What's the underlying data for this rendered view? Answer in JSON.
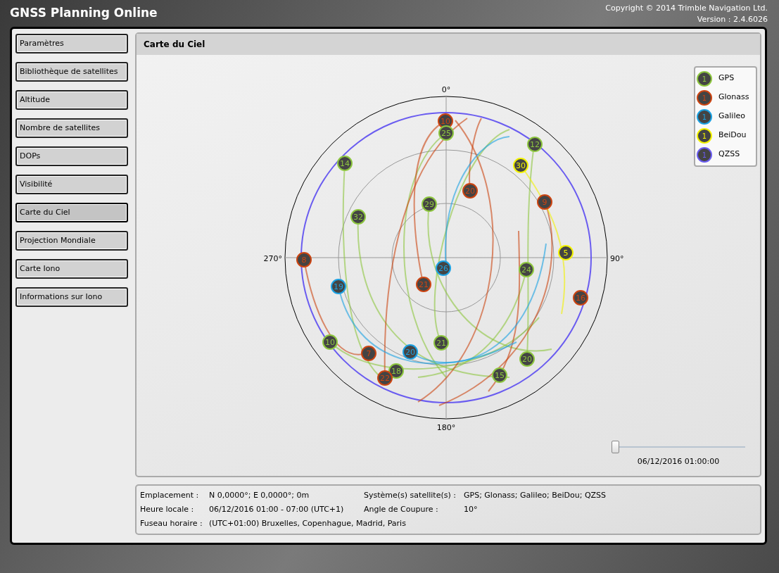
{
  "app": {
    "title": "GNSS Planning Online",
    "copyright": "Copyright © 2014 Trimble Navigation Ltd.",
    "version": "Version : 2.4.6026"
  },
  "sidebar": {
    "items": [
      {
        "label": "Paramètres",
        "selected": false
      },
      {
        "label": "Bibliothèque de satellites",
        "selected": false
      },
      {
        "label": "Altitude",
        "selected": false
      },
      {
        "label": "Nombre de satellites",
        "selected": false
      },
      {
        "label": "DOPs",
        "selected": false
      },
      {
        "label": "Visibilité",
        "selected": false
      },
      {
        "label": "Carte du Ciel",
        "selected": true
      },
      {
        "label": "Projection Mondiale",
        "selected": false
      },
      {
        "label": "Carte Iono",
        "selected": false
      },
      {
        "label": "Informations sur Iono",
        "selected": false
      }
    ]
  },
  "panel": {
    "title": "Carte du Ciel",
    "sky_plot": {
      "direction_labels": [
        "0°",
        "90°",
        "180°",
        "270°"
      ],
      "satellites": [
        {
          "number": "10",
          "kind": "glonass"
        },
        {
          "number": "25",
          "kind": "gps"
        },
        {
          "number": "12",
          "kind": "gps"
        },
        {
          "number": "14",
          "kind": "gps"
        },
        {
          "number": "30",
          "kind": "beidou"
        },
        {
          "number": "20",
          "kind": "glonass"
        },
        {
          "number": "9",
          "kind": "glonass"
        },
        {
          "number": "29",
          "kind": "gps"
        },
        {
          "number": "32",
          "kind": "gps"
        },
        {
          "number": "5",
          "kind": "beidou"
        },
        {
          "number": "8",
          "kind": "glonass"
        },
        {
          "number": "26",
          "kind": "galileo"
        },
        {
          "number": "24",
          "kind": "gps"
        },
        {
          "number": "21",
          "kind": "glonass"
        },
        {
          "number": "19",
          "kind": "galileo"
        },
        {
          "number": "16",
          "kind": "glonass"
        },
        {
          "number": "10",
          "kind": "gps"
        },
        {
          "number": "21",
          "kind": "gps"
        },
        {
          "number": "7",
          "kind": "glonass"
        },
        {
          "number": "20",
          "kind": "galileo"
        },
        {
          "number": "20",
          "kind": "gps"
        },
        {
          "number": "18",
          "kind": "gps"
        },
        {
          "number": "22",
          "kind": "glonass"
        },
        {
          "number": "15",
          "kind": "gps"
        }
      ]
    },
    "legend": [
      {
        "kind": "gps",
        "symbol": "1",
        "label": "GPS",
        "color": "#8dc63f"
      },
      {
        "kind": "glonass",
        "symbol": "1",
        "label": "Glonass",
        "color": "#cc4411"
      },
      {
        "kind": "galileo",
        "symbol": "1",
        "label": "Galileo",
        "color": "#1ba1e2"
      },
      {
        "kind": "beidou",
        "symbol": "1",
        "label": "BeiDou",
        "color": "#f2f200"
      },
      {
        "kind": "qzss",
        "symbol": "1",
        "label": "QZSS",
        "color": "#6a5cf0"
      }
    ],
    "time_slider": {
      "level": 0,
      "reading": "06/12/2016 01:00:00"
    }
  },
  "info": [
    {
      "label": "Emplacement :",
      "value": "N 0,0000°; E 0,0000°; 0m"
    },
    {
      "label": "Système(s) satellite(s) :",
      "value": "GPS; Glonass; Galileo; BeiDou; QZSS"
    },
    {
      "label": "Heure locale :",
      "value": "06/12/2016 01:00 - 07:00 (UTC+1)"
    },
    {
      "label": "Angle de Coupure :",
      "value": "10°"
    },
    {
      "label": "Fuseau horaire :",
      "value": "(UTC+01:00) Bruxelles, Copenhague, Madrid, Paris"
    }
  ]
}
